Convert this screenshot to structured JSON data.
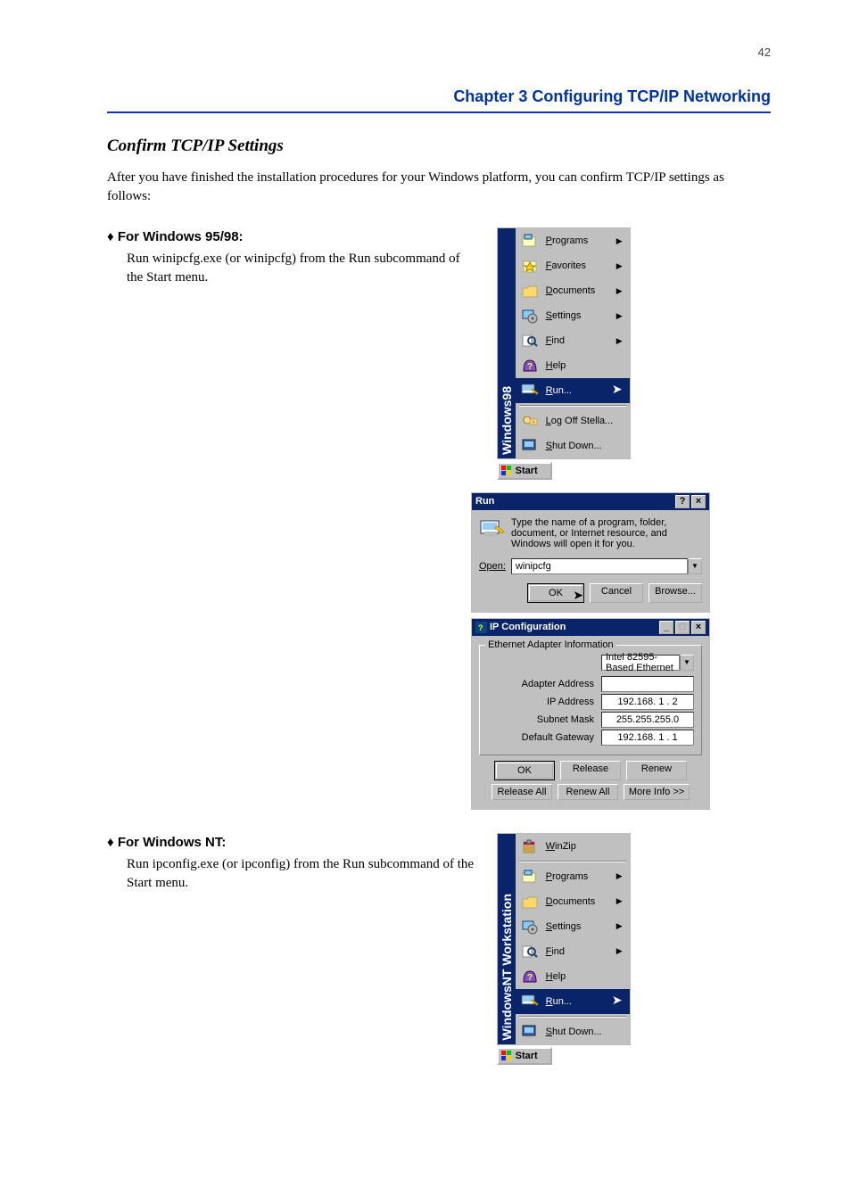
{
  "page_number": "42",
  "chapter_header": "Chapter 3 Configuring TCP/IP Networking",
  "section_heading": "Confirm TCP/IP Settings",
  "intro_para": "After you have finished the installation procedures for your Windows platform, you can confirm TCP/IP settings as follows:",
  "win98": {
    "bullet": "For Windows 95/98:",
    "step": "Run winipcfg.exe (or winipcfg) from the Run subcommand of the Start menu.",
    "start_menu_brand": "Windows98",
    "start_items": [
      {
        "label": "Programs",
        "arrow": true
      },
      {
        "label": "Favorites",
        "arrow": true
      },
      {
        "label": "Documents",
        "arrow": true
      },
      {
        "label": "Settings",
        "arrow": true
      },
      {
        "label": "Find",
        "arrow": true
      },
      {
        "label": "Help",
        "arrow": false
      },
      {
        "label": "Run...",
        "arrow": false,
        "selected": true
      },
      {
        "label": "Log Off Stella...",
        "arrow": false,
        "sep_before": true
      },
      {
        "label": "Shut Down...",
        "arrow": false
      }
    ],
    "start_button": "Start",
    "run": {
      "title": "Run",
      "prompt": "Type the name of a program, folder, document, or Internet resource, and Windows will open it for you.",
      "open_label": "Open:",
      "open_value": "winipcfg",
      "ok": "OK",
      "cancel": "Cancel",
      "browse": "Browse..."
    },
    "ipcfg": {
      "title": "IP Configuration",
      "group": "Ethernet Adapter Information",
      "adapter_sel": "Intel 82595-Based Ethernet",
      "rows": [
        {
          "k": "Adapter Address",
          "v": ""
        },
        {
          "k": "IP Address",
          "v": "192.168.  1 .  2"
        },
        {
          "k": "Subnet Mask",
          "v": "255.255.255.0"
        },
        {
          "k": "Default Gateway",
          "v": "192.168.  1 .  1"
        }
      ],
      "btns": [
        "OK",
        "Release",
        "Renew",
        "Release All",
        "Renew All",
        "More Info >>"
      ]
    }
  },
  "winnt": {
    "bullet": "For Windows NT:",
    "step": "Run ipconfig.exe (or ipconfig) from the Run subcommand of the Start menu.",
    "start_menu_brand": "WindowsNT Workstation",
    "start_items": [
      {
        "label": "WinZip",
        "arrow": false,
        "sep_after": true
      },
      {
        "label": "Programs",
        "arrow": true
      },
      {
        "label": "Documents",
        "arrow": true
      },
      {
        "label": "Settings",
        "arrow": true
      },
      {
        "label": "Find",
        "arrow": true
      },
      {
        "label": "Help",
        "arrow": false
      },
      {
        "label": "Run...",
        "arrow": false,
        "selected": true,
        "sep_after": true
      },
      {
        "label": "Shut Down...",
        "arrow": false
      }
    ],
    "start_button": "Start"
  }
}
